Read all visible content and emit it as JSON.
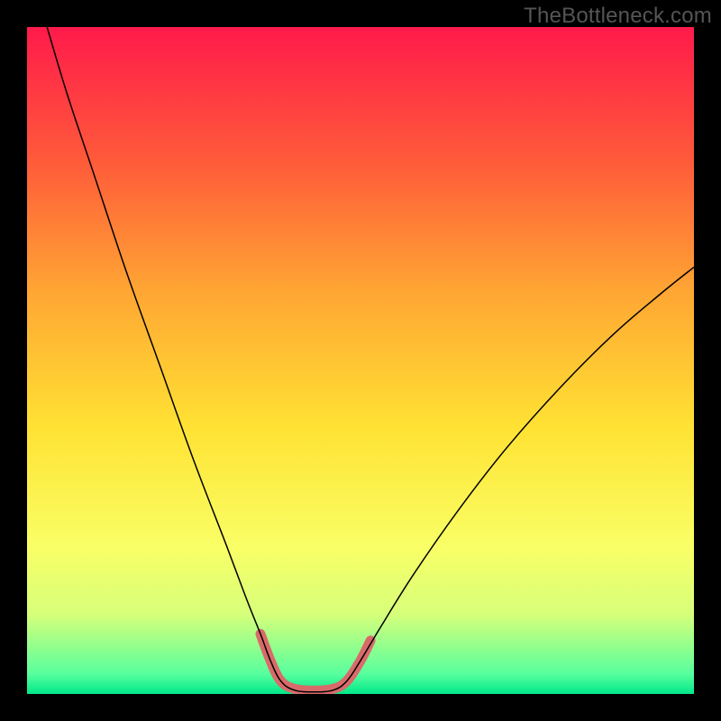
{
  "watermark": "TheBottleneck.com",
  "chart_data": {
    "type": "line",
    "title": "",
    "xlabel": "",
    "ylabel": "",
    "xlim": [
      0,
      100
    ],
    "ylim": [
      0,
      100
    ],
    "gradient_stops": [
      {
        "offset": 0.0,
        "color": "#ff1a4b"
      },
      {
        "offset": 0.2,
        "color": "#ff5a3a"
      },
      {
        "offset": 0.4,
        "color": "#ffa733"
      },
      {
        "offset": 0.6,
        "color": "#ffe233"
      },
      {
        "offset": 0.78,
        "color": "#f9ff66"
      },
      {
        "offset": 0.88,
        "color": "#d7ff7a"
      },
      {
        "offset": 0.97,
        "color": "#58ff9e"
      },
      {
        "offset": 1.0,
        "color": "#00e88a"
      }
    ],
    "series": [
      {
        "name": "bottleneck-curve",
        "stroke": "#000000",
        "stroke_width": 1.5,
        "points": [
          {
            "x": 3.0,
            "y": 100.0
          },
          {
            "x": 6.0,
            "y": 90.0
          },
          {
            "x": 10.0,
            "y": 78.0
          },
          {
            "x": 15.0,
            "y": 63.0
          },
          {
            "x": 20.0,
            "y": 49.0
          },
          {
            "x": 25.0,
            "y": 35.0
          },
          {
            "x": 30.0,
            "y": 22.0
          },
          {
            "x": 33.0,
            "y": 14.0
          },
          {
            "x": 35.0,
            "y": 9.0
          },
          {
            "x": 36.5,
            "y": 5.0
          },
          {
            "x": 38.0,
            "y": 2.0
          },
          {
            "x": 40.0,
            "y": 0.6
          },
          {
            "x": 43.0,
            "y": 0.3
          },
          {
            "x": 46.0,
            "y": 0.6
          },
          {
            "x": 48.0,
            "y": 2.0
          },
          {
            "x": 50.0,
            "y": 5.0
          },
          {
            "x": 53.0,
            "y": 10.0
          },
          {
            "x": 58.0,
            "y": 18.0
          },
          {
            "x": 65.0,
            "y": 28.0
          },
          {
            "x": 72.0,
            "y": 37.0
          },
          {
            "x": 80.0,
            "y": 46.0
          },
          {
            "x": 88.0,
            "y": 54.0
          },
          {
            "x": 95.0,
            "y": 60.0
          },
          {
            "x": 100.0,
            "y": 64.0
          }
        ]
      },
      {
        "name": "optimal-zone-highlight",
        "stroke": "#d96a6a",
        "stroke_width": 11,
        "linecap": "round",
        "points": [
          {
            "x": 35.0,
            "y": 9.0
          },
          {
            "x": 36.5,
            "y": 5.0
          },
          {
            "x": 38.0,
            "y": 2.0
          },
          {
            "x": 40.0,
            "y": 0.8
          },
          {
            "x": 43.0,
            "y": 0.5
          },
          {
            "x": 46.0,
            "y": 0.8
          },
          {
            "x": 48.0,
            "y": 2.0
          },
          {
            "x": 50.0,
            "y": 5.0
          },
          {
            "x": 51.5,
            "y": 8.0
          }
        ]
      }
    ]
  }
}
